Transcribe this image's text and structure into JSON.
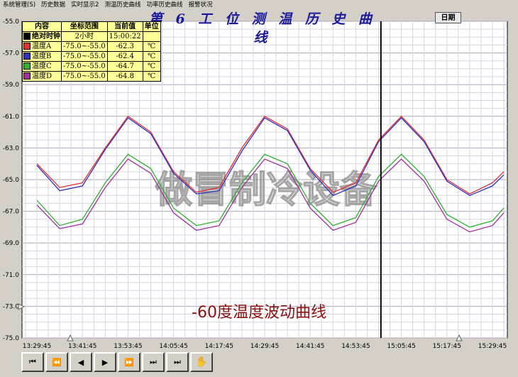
{
  "menu": [
    "系统管理(S)",
    "历史数据",
    "实时显示2",
    "测温历史曲线",
    "功率历史曲线",
    "报警状况"
  ],
  "title": "第 6 工 位 测 温 历 史 曲 线",
  "date_button": "日期",
  "legend": {
    "headers": [
      "内容",
      "坐标范围",
      "当前值",
      "单位"
    ],
    "clock": {
      "label": "绝对时钟",
      "range": "2小时",
      "value": "15:00:22",
      "color": "#000000"
    },
    "rows": [
      {
        "label": "温度A",
        "range": "-75.0~-55.0",
        "value": "-62.3",
        "unit": "℃",
        "color": "#e03030"
      },
      {
        "label": "温度B",
        "range": "-75.0~-55.0",
        "value": "-62.4",
        "unit": "℃",
        "color": "#3030c0"
      },
      {
        "label": "温度C",
        "range": "-75.0~-55.0",
        "value": "-64.7",
        "unit": "℃",
        "color": "#30b030"
      },
      {
        "label": "温度D",
        "range": "-75.0~-55.0",
        "value": "-64.8",
        "unit": "℃",
        "color": "#a030a0"
      }
    ]
  },
  "watermark": "做冒制冷设备",
  "annotation": "-60度温度波动曲线",
  "controls": [
    "⏮",
    "⏪",
    "◀",
    "▶",
    "⏩",
    "⏭",
    "⏭",
    "✋"
  ],
  "chart_data": {
    "type": "line",
    "ylim": [
      -75.0,
      -55.0
    ],
    "y_ticks": [
      "-55.0",
      "-57.0",
      "-59.0",
      "-61.0",
      "-63.0",
      "-65.0",
      "-67.0",
      "-69.0",
      "-71.0",
      "-73.0",
      "-75.0"
    ],
    "x_ticks": [
      "13:29:45",
      "13:41:45",
      "13:53:45",
      "14:05:45",
      "14:17:45",
      "14:29:45",
      "14:41:45",
      "14:53:45",
      "15:05:45",
      "15:17:45",
      "15:29:45"
    ],
    "cursor_time": "15:00:22",
    "grid": true,
    "series": [
      {
        "name": "温度A",
        "color": "#e03030",
        "x": [
          "13:29:45",
          "13:35:45",
          "13:41:45",
          "13:47:45",
          "13:53:45",
          "13:59:45",
          "14:05:45",
          "14:11:45",
          "14:17:45",
          "14:23:45",
          "14:29:45",
          "14:35:45",
          "14:41:45",
          "14:47:45",
          "14:53:45",
          "14:59:45",
          "15:05:45",
          "15:11:45",
          "15:17:45",
          "15:23:45",
          "15:29:45",
          "15:32:45"
        ],
        "values": [
          -64.0,
          -65.5,
          -65.2,
          -63.0,
          -61.0,
          -62.0,
          -64.5,
          -65.8,
          -65.5,
          -63.0,
          -61.0,
          -61.8,
          -64.3,
          -65.8,
          -65.2,
          -62.5,
          -61.0,
          -62.5,
          -65.0,
          -65.9,
          -65.2,
          -64.5
        ]
      },
      {
        "name": "温度B",
        "color": "#3030c0",
        "x": [
          "13:29:45",
          "13:35:45",
          "13:41:45",
          "13:47:45",
          "13:53:45",
          "13:59:45",
          "14:05:45",
          "14:11:45",
          "14:17:45",
          "14:23:45",
          "14:29:45",
          "14:35:45",
          "14:41:45",
          "14:47:45",
          "14:53:45",
          "14:59:45",
          "15:05:45",
          "15:11:45",
          "15:17:45",
          "15:23:45",
          "15:29:45",
          "15:32:45"
        ],
        "values": [
          -64.1,
          -65.7,
          -65.4,
          -63.1,
          -61.1,
          -62.1,
          -64.6,
          -65.9,
          -65.7,
          -63.2,
          -61.1,
          -61.9,
          -64.4,
          -66.0,
          -65.4,
          -62.6,
          -61.1,
          -62.6,
          -65.1,
          -66.0,
          -65.4,
          -64.7
        ]
      },
      {
        "name": "温度C",
        "color": "#30b030",
        "x": [
          "13:29:45",
          "13:35:45",
          "13:41:45",
          "13:47:45",
          "13:53:45",
          "13:59:45",
          "14:05:45",
          "14:11:45",
          "14:17:45",
          "14:23:45",
          "14:29:45",
          "14:35:45",
          "14:41:45",
          "14:47:45",
          "14:53:45",
          "14:59:45",
          "15:05:45",
          "15:11:45",
          "15:17:45",
          "15:23:45",
          "15:29:45",
          "15:32:45"
        ],
        "values": [
          -66.3,
          -67.9,
          -67.5,
          -65.2,
          -63.4,
          -64.3,
          -66.8,
          -67.9,
          -67.6,
          -65.2,
          -63.4,
          -64.0,
          -66.5,
          -67.9,
          -67.4,
          -64.8,
          -63.4,
          -64.8,
          -67.2,
          -68.0,
          -67.6,
          -66.8
        ]
      },
      {
        "name": "温度D",
        "color": "#a030a0",
        "x": [
          "13:29:45",
          "13:35:45",
          "13:41:45",
          "13:47:45",
          "13:53:45",
          "13:59:45",
          "14:05:45",
          "14:11:45",
          "14:17:45",
          "14:23:45",
          "14:29:45",
          "14:35:45",
          "14:41:45",
          "14:47:45",
          "14:53:45",
          "14:59:45",
          "15:05:45",
          "15:11:45",
          "15:17:45",
          "15:23:45",
          "15:29:45",
          "15:32:45"
        ],
        "values": [
          -66.6,
          -68.1,
          -67.8,
          -65.5,
          -63.7,
          -64.6,
          -67.1,
          -68.2,
          -67.9,
          -65.5,
          -63.7,
          -64.3,
          -66.8,
          -68.2,
          -67.7,
          -65.1,
          -63.7,
          -65.1,
          -67.5,
          -68.3,
          -67.9,
          -67.1
        ]
      }
    ]
  }
}
